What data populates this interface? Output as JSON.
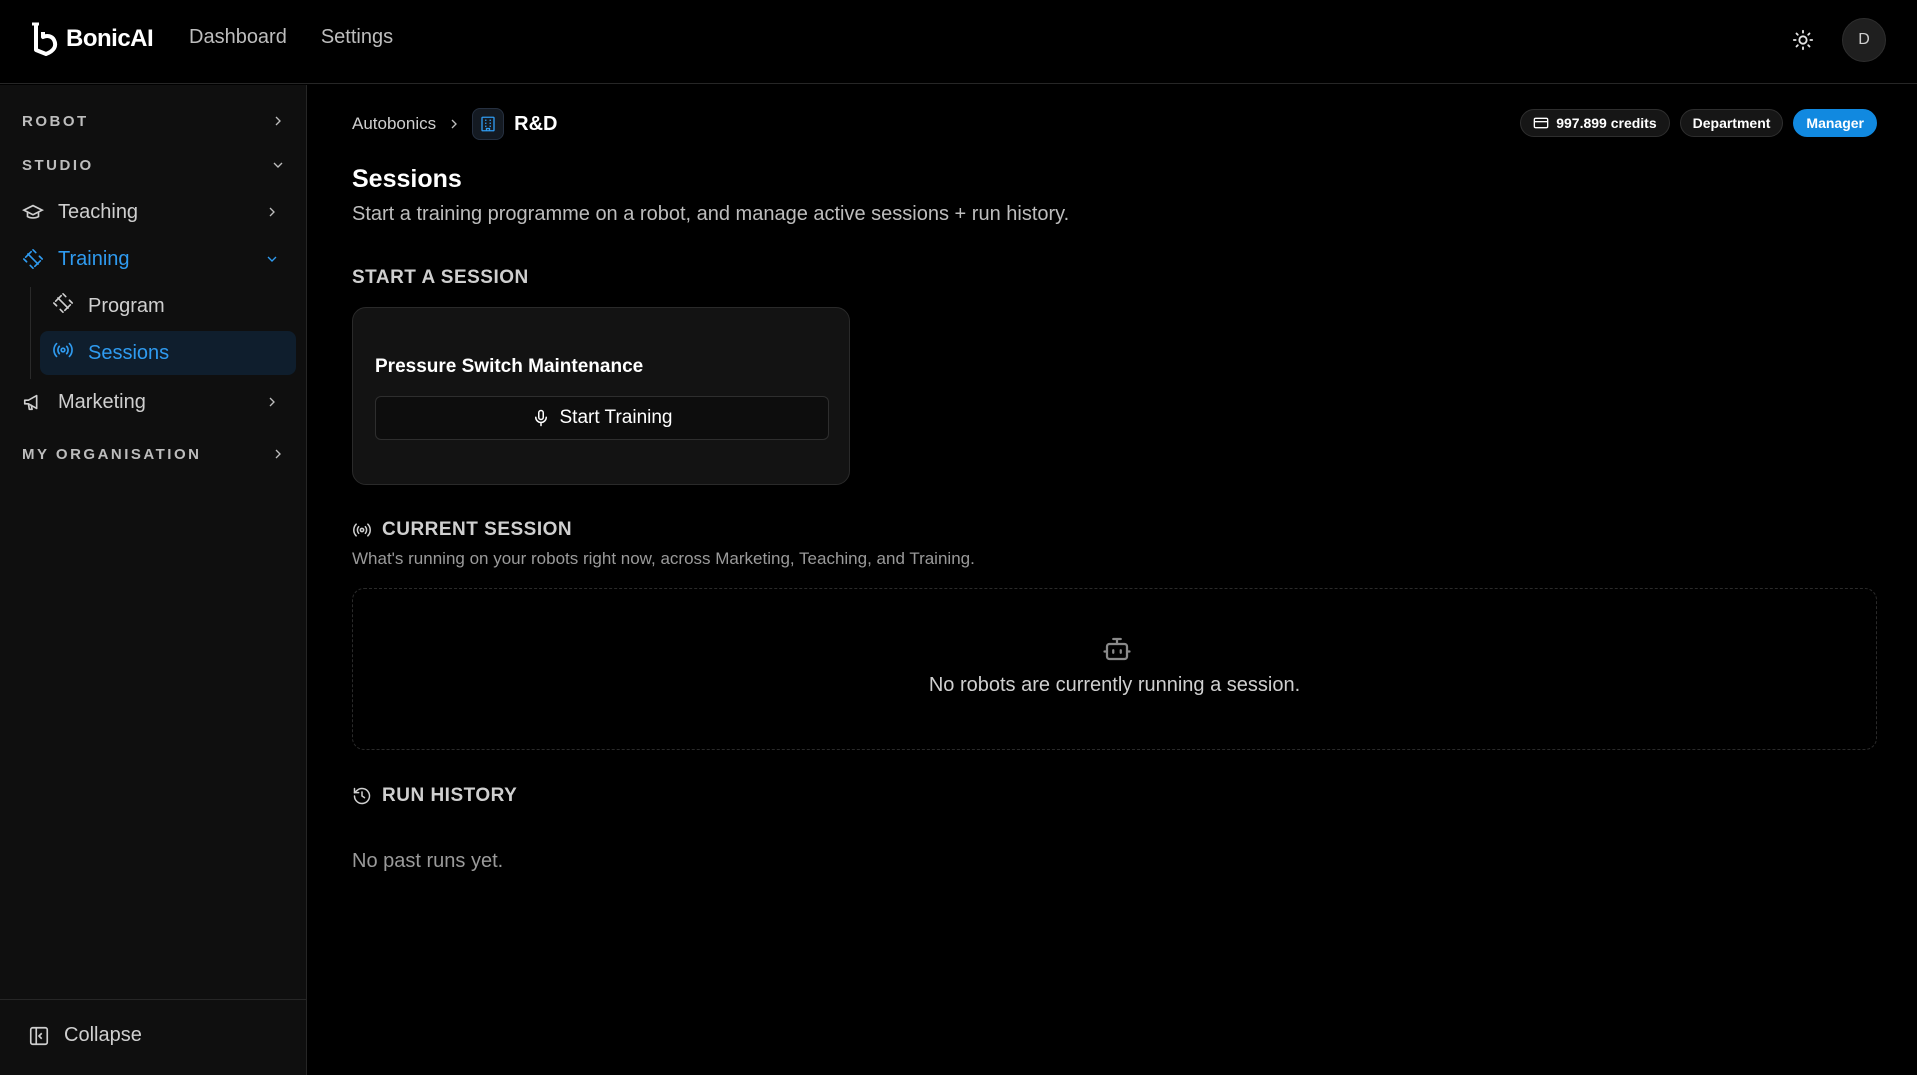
{
  "brand": {
    "name": "BonicAI"
  },
  "topnav": {
    "dashboard": "Dashboard",
    "settings": "Settings"
  },
  "user": {
    "initial": "D"
  },
  "sidebar": {
    "robot": "ROBOT",
    "studio": "STUDIO",
    "teaching": "Teaching",
    "training": "Training",
    "program": "Program",
    "sessions": "Sessions",
    "marketing": "Marketing",
    "my_org": "MY ORGANISATION",
    "collapse": "Collapse"
  },
  "breadcrumb": {
    "root": "Autobonics",
    "current": "R&D"
  },
  "badges": {
    "credits": "997.899 credits",
    "department": "Department",
    "role": "Manager"
  },
  "page": {
    "title": "Sessions",
    "subtitle": "Start a training programme on a robot, and manage active sessions + run history."
  },
  "start_section": {
    "label": "START A SESSION",
    "card_title": "Pressure Switch Maintenance",
    "button": "Start Training"
  },
  "current_section": {
    "label": "CURRENT SESSION",
    "description": "What's running on your robots right now, across Marketing, Teaching, and Training.",
    "empty": "No robots are currently running a session."
  },
  "history_section": {
    "label": "RUN HISTORY",
    "empty": "No past runs yet."
  },
  "colors": {
    "accent": "#2f9bf0",
    "manager_badge": "#1189e0",
    "background": "#000000"
  }
}
